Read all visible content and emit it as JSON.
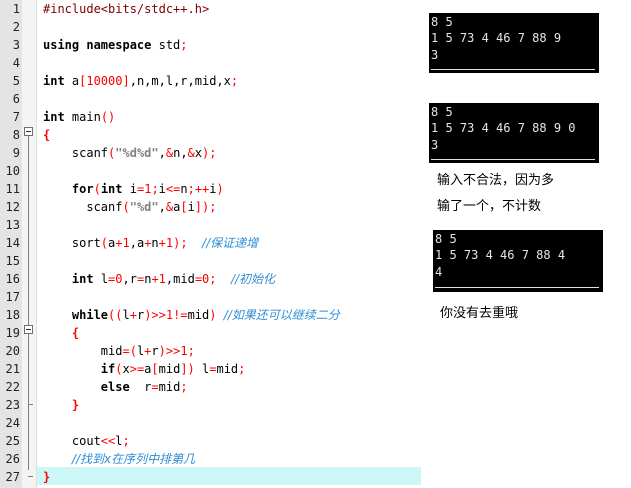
{
  "editor": {
    "lines": [
      {
        "n": "1",
        "html": "<span class='pp'>#include&lt;bits/stdc++.h&gt;</span>"
      },
      {
        "n": "2",
        "html": ""
      },
      {
        "n": "3",
        "html": "<span class='kw2'>using namespace</span> std<span class='op'>;</span>"
      },
      {
        "n": "4",
        "html": ""
      },
      {
        "n": "5",
        "html": "<span class='kw2'>int</span> a<span class='op'>[</span><span class='num'>10000</span><span class='op'>]</span>,n,m,l,r,mid,x<span class='op'>;</span>"
      },
      {
        "n": "6",
        "html": ""
      },
      {
        "n": "7",
        "html": "<span class='kw2'>int</span> main<span class='op'>()</span>"
      },
      {
        "n": "8",
        "html": "<span class='br'>{</span>"
      },
      {
        "n": "9",
        "html": "    scanf<span class='op'>(</span><span class='str'>\"%d%d\"</span>,<span class='op'>&amp;</span>n,<span class='op'>&amp;</span>x<span class='op'>);</span>"
      },
      {
        "n": "10",
        "html": ""
      },
      {
        "n": "11",
        "html": "    <span class='kw2'>for</span><span class='op'>(</span><span class='kw2'>int</span> i<span class='op'>=</span><span class='num'>1</span><span class='op'>;</span>i<span class='op'>&lt;=</span>n<span class='op'>;++</span>i<span class='op'>)</span>"
      },
      {
        "n": "12",
        "html": "      scanf<span class='op'>(</span><span class='str'>\"%d\"</span>,<span class='op'>&amp;</span>a<span class='op'>[</span>i<span class='op'>]);</span>"
      },
      {
        "n": "13",
        "html": ""
      },
      {
        "n": "14",
        "html": "    sort<span class='op'>(</span>a<span class='op'>+</span><span class='num'>1</span>,a<span class='op'>+</span>n<span class='op'>+</span><span class='num'>1</span><span class='op'>);</span>  <span class='cm'>//保证递增</span>"
      },
      {
        "n": "15",
        "html": ""
      },
      {
        "n": "16",
        "html": "    <span class='kw2'>int</span> l<span class='op'>=</span><span class='num'>0</span>,r<span class='op'>=</span>n<span class='op'>+</span><span class='num'>1</span>,mid<span class='op'>=</span><span class='num'>0</span><span class='op'>;</span>  <span class='cm'>//初始化</span>"
      },
      {
        "n": "17",
        "html": ""
      },
      {
        "n": "18",
        "html": "    <span class='kw2'>while</span><span class='op'>((</span>l<span class='op'>+</span>r<span class='op'>)&gt;&gt;</span><span class='num'>1</span><span class='op'>!=</span>mid<span class='op'>)</span> <span class='cm'>//如果还可以继续二分</span>"
      },
      {
        "n": "19",
        "html": "    <span class='br'>{</span>"
      },
      {
        "n": "20",
        "html": "        mid<span class='op'>=(</span>l<span class='op'>+</span>r<span class='op'>)&gt;&gt;</span><span class='num'>1</span><span class='op'>;</span>"
      },
      {
        "n": "21",
        "html": "        <span class='kw2'>if</span><span class='op'>(</span>x<span class='op'>&gt;=</span>a<span class='op'>[</span>mid<span class='op'>])</span> l<span class='op'>=</span>mid<span class='op'>;</span>"
      },
      {
        "n": "22",
        "html": "        <span class='kw2'>else</span>  r<span class='op'>=</span>mid<span class='op'>;</span>"
      },
      {
        "n": "23",
        "html": "    <span class='br'>}</span>"
      },
      {
        "n": "24",
        "html": ""
      },
      {
        "n": "25",
        "html": "    cout<span class='op'>&lt;&lt;</span>l<span class='op'>;</span>"
      },
      {
        "n": "26",
        "html": "    <span class='cm'>//找到x在序列中排第几</span>"
      },
      {
        "n": "27",
        "html": "<span class='br'>}</span>"
      }
    ]
  },
  "terminals": [
    {
      "lines": [
        "8 5",
        "1 5 73 4 46 7 88 9",
        "3"
      ]
    },
    {
      "lines": [
        "8 5",
        "1 5 73 4 46 7 88 9 0",
        "3"
      ]
    },
    {
      "lines": [
        "8 5",
        "1 5 73 4 46 7 88 4",
        "4"
      ]
    }
  ],
  "notes": {
    "note1_line1": "输入不合法，因为多",
    "note1_line2": "输了一个，不计数",
    "note2": "你没有去重哦"
  }
}
